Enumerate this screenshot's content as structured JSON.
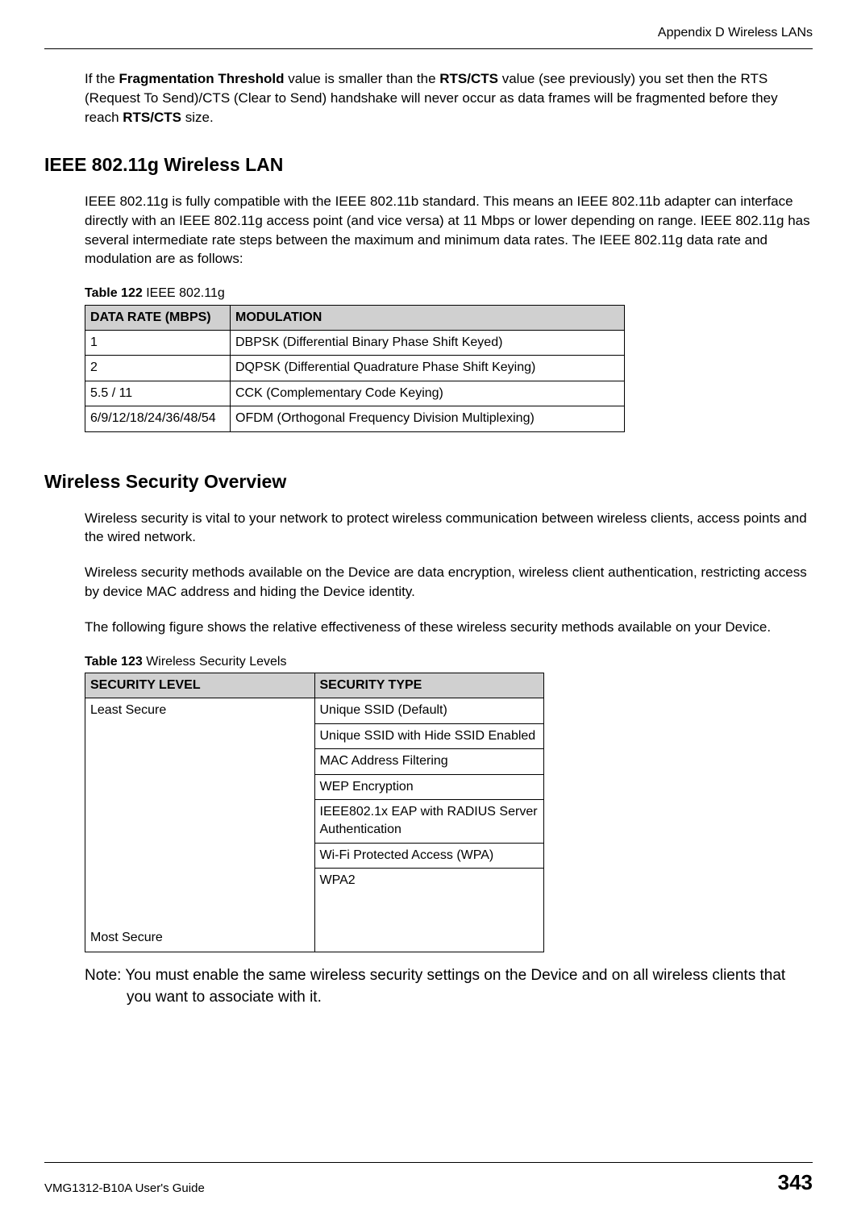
{
  "header": {
    "appendix_title": "Appendix D Wireless LANs"
  },
  "paragraphs": {
    "frag_threshold_prefix": "If the ",
    "frag_threshold_bold1": "Fragmentation Threshold",
    "frag_threshold_mid1": " value is smaller than the ",
    "frag_threshold_bold2": "RTS/CTS",
    "frag_threshold_mid2": " value (see previously) you set then the RTS (Request To Send)/CTS (Clear to Send) handshake will never occur as data frames will be fragmented before they reach ",
    "frag_threshold_bold3": "RTS/CTS",
    "frag_threshold_suffix": " size.",
    "ieee80211g_body": "IEEE 802.11g is fully compatible with the IEEE 802.11b standard. This means an IEEE 802.11b adapter can interface directly with an IEEE 802.11g access point (and vice versa) at 11 Mbps or lower depending on range. IEEE 802.11g has several intermediate rate steps between the maximum and minimum data rates. The IEEE 802.11g data rate and modulation are as follows:",
    "wso_p1": "Wireless security is vital to your network to protect wireless communication between wireless clients, access points and the wired network.",
    "wso_p2": "Wireless security methods available on the Device are data encryption, wireless client authentication, restricting access by device MAC address and hiding the Device identity.",
    "wso_p3": "The following figure shows the relative effectiveness of these wireless security methods available on your Device.",
    "note": "Note: You must enable the same wireless security settings on the Device and on all wireless clients that you want to associate with it."
  },
  "headings": {
    "h1_ieee": "IEEE 802.11g Wireless LAN",
    "h1_wso": "Wireless Security Overview"
  },
  "table122": {
    "caption_label": "Table 122",
    "caption_text": "   IEEE 802.11g",
    "header": {
      "col0": "DATA RATE (MBPS)",
      "col1": "MODULATION"
    },
    "rows": [
      {
        "rate": "1",
        "mod": "DBPSK (Differential Binary Phase Shift Keyed)"
      },
      {
        "rate": "2",
        "mod": "DQPSK (Differential Quadrature Phase Shift Keying)"
      },
      {
        "rate": "5.5 / 11",
        "mod": "CCK (Complementary Code Keying)"
      },
      {
        "rate": "6/9/12/18/24/36/48/54",
        "mod": "OFDM (Orthogonal Frequency Division Multiplexing)"
      }
    ]
  },
  "table123": {
    "caption_label": "Table 123",
    "caption_text": "   Wireless Security Levels",
    "header": {
      "col0": "SECURITY LEVEL",
      "col1": "SECURITY TYPE"
    },
    "level_top": "Least Secure",
    "level_bottom": "Most Secure",
    "types": [
      "Unique SSID (Default)",
      "Unique SSID with Hide SSID Enabled",
      "MAC Address Filtering",
      "WEP Encryption",
      "IEEE802.1x EAP with RADIUS Server Authentication",
      "Wi-Fi Protected Access (WPA)",
      "WPA2"
    ]
  },
  "footer": {
    "guide": "VMG1312-B10A User's Guide",
    "page": "343"
  }
}
